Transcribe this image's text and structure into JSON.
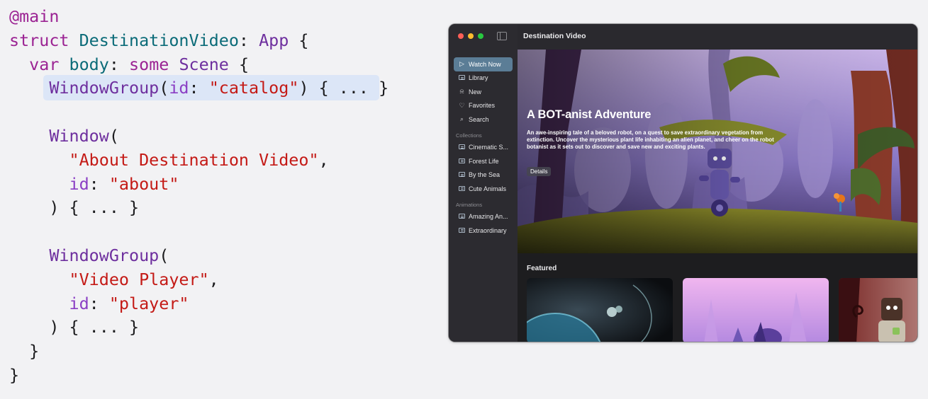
{
  "code": {
    "lines": [
      [
        {
          "t": "@main",
          "c": "kw"
        }
      ],
      [
        {
          "t": "struct ",
          "c": "kw"
        },
        {
          "t": "DestinationVideo",
          "c": "ty"
        },
        {
          "t": ": ",
          "c": ""
        },
        {
          "t": "App",
          "c": "tp"
        },
        {
          "t": " {",
          "c": ""
        }
      ],
      [
        {
          "t": "  ",
          "c": ""
        },
        {
          "t": "var ",
          "c": "kw"
        },
        {
          "t": "body",
          "c": "ty"
        },
        {
          "t": ": ",
          "c": ""
        },
        {
          "t": "some ",
          "c": "kw"
        },
        {
          "t": "Scene",
          "c": "tp"
        },
        {
          "t": " {",
          "c": ""
        }
      ],
      [
        {
          "t": "    ",
          "c": ""
        },
        {
          "t": "WindowGroup",
          "c": "tp"
        },
        {
          "t": "(",
          "c": ""
        },
        {
          "t": "id",
          "c": "lb"
        },
        {
          "t": ": ",
          "c": ""
        },
        {
          "t": "\"catalog\"",
          "c": "st"
        },
        {
          "t": ") { ... }",
          "c": ""
        }
      ],
      [],
      [
        {
          "t": "    ",
          "c": ""
        },
        {
          "t": "Window",
          "c": "tp"
        },
        {
          "t": "(",
          "c": ""
        }
      ],
      [
        {
          "t": "      ",
          "c": ""
        },
        {
          "t": "\"About Destination Video\"",
          "c": "st"
        },
        {
          "t": ",",
          "c": ""
        }
      ],
      [
        {
          "t": "      ",
          "c": ""
        },
        {
          "t": "id",
          "c": "lb"
        },
        {
          "t": ": ",
          "c": ""
        },
        {
          "t": "\"about\"",
          "c": "st"
        }
      ],
      [
        {
          "t": "    ) { ... }",
          "c": ""
        }
      ],
      [],
      [
        {
          "t": "    ",
          "c": ""
        },
        {
          "t": "WindowGroup",
          "c": "tp"
        },
        {
          "t": "(",
          "c": ""
        }
      ],
      [
        {
          "t": "      ",
          "c": ""
        },
        {
          "t": "\"Video Player\"",
          "c": "st"
        },
        {
          "t": ",",
          "c": ""
        }
      ],
      [
        {
          "t": "      ",
          "c": ""
        },
        {
          "t": "id",
          "c": "lb"
        },
        {
          "t": ": ",
          "c": ""
        },
        {
          "t": "\"player\"",
          "c": "st"
        }
      ],
      [
        {
          "t": "    ) { ... }",
          "c": ""
        }
      ],
      [
        {
          "t": "  }",
          "c": ""
        }
      ],
      [
        {
          "t": "}",
          "c": ""
        }
      ]
    ],
    "highlighted_line": 3,
    "colors": {
      "keyword": "#9b2393",
      "type": "#0b6b78",
      "protocol": "#6e2f9e",
      "string": "#c41a16",
      "label": "#8a3ec4",
      "highlight": "#dce6f7"
    }
  },
  "app": {
    "title": "Destination Video",
    "sidebar": {
      "nav": [
        {
          "label": "Watch Now",
          "icon": "play-icon",
          "active": true
        },
        {
          "label": "Library",
          "icon": "library-icon"
        },
        {
          "label": "New",
          "icon": "bell-icon"
        },
        {
          "label": "Favorites",
          "icon": "heart-icon"
        },
        {
          "label": "Search",
          "icon": "search-icon"
        }
      ],
      "sections": [
        {
          "title": "Collections",
          "items": [
            "Cinematic S...",
            "Forest Life",
            "By the Sea",
            "Cute Animals"
          ]
        },
        {
          "title": "Animations",
          "items": [
            "Amazing An...",
            "Extraordinary"
          ]
        }
      ]
    },
    "hero": {
      "title": "A BOT-anist Adventure",
      "description": "An awe-inspiring tale of a beloved robot, on a quest to save extraordinary vegetation from extinction. Uncover the mysterious plant life inhabiting an alien planet, and cheer on the robot botanist as it sets out to discover and save new and exciting plants.",
      "button": "Details"
    },
    "featured": {
      "title": "Featured",
      "cards": [
        "space-scene",
        "purple-forest-scene",
        "robot-scene"
      ]
    }
  }
}
